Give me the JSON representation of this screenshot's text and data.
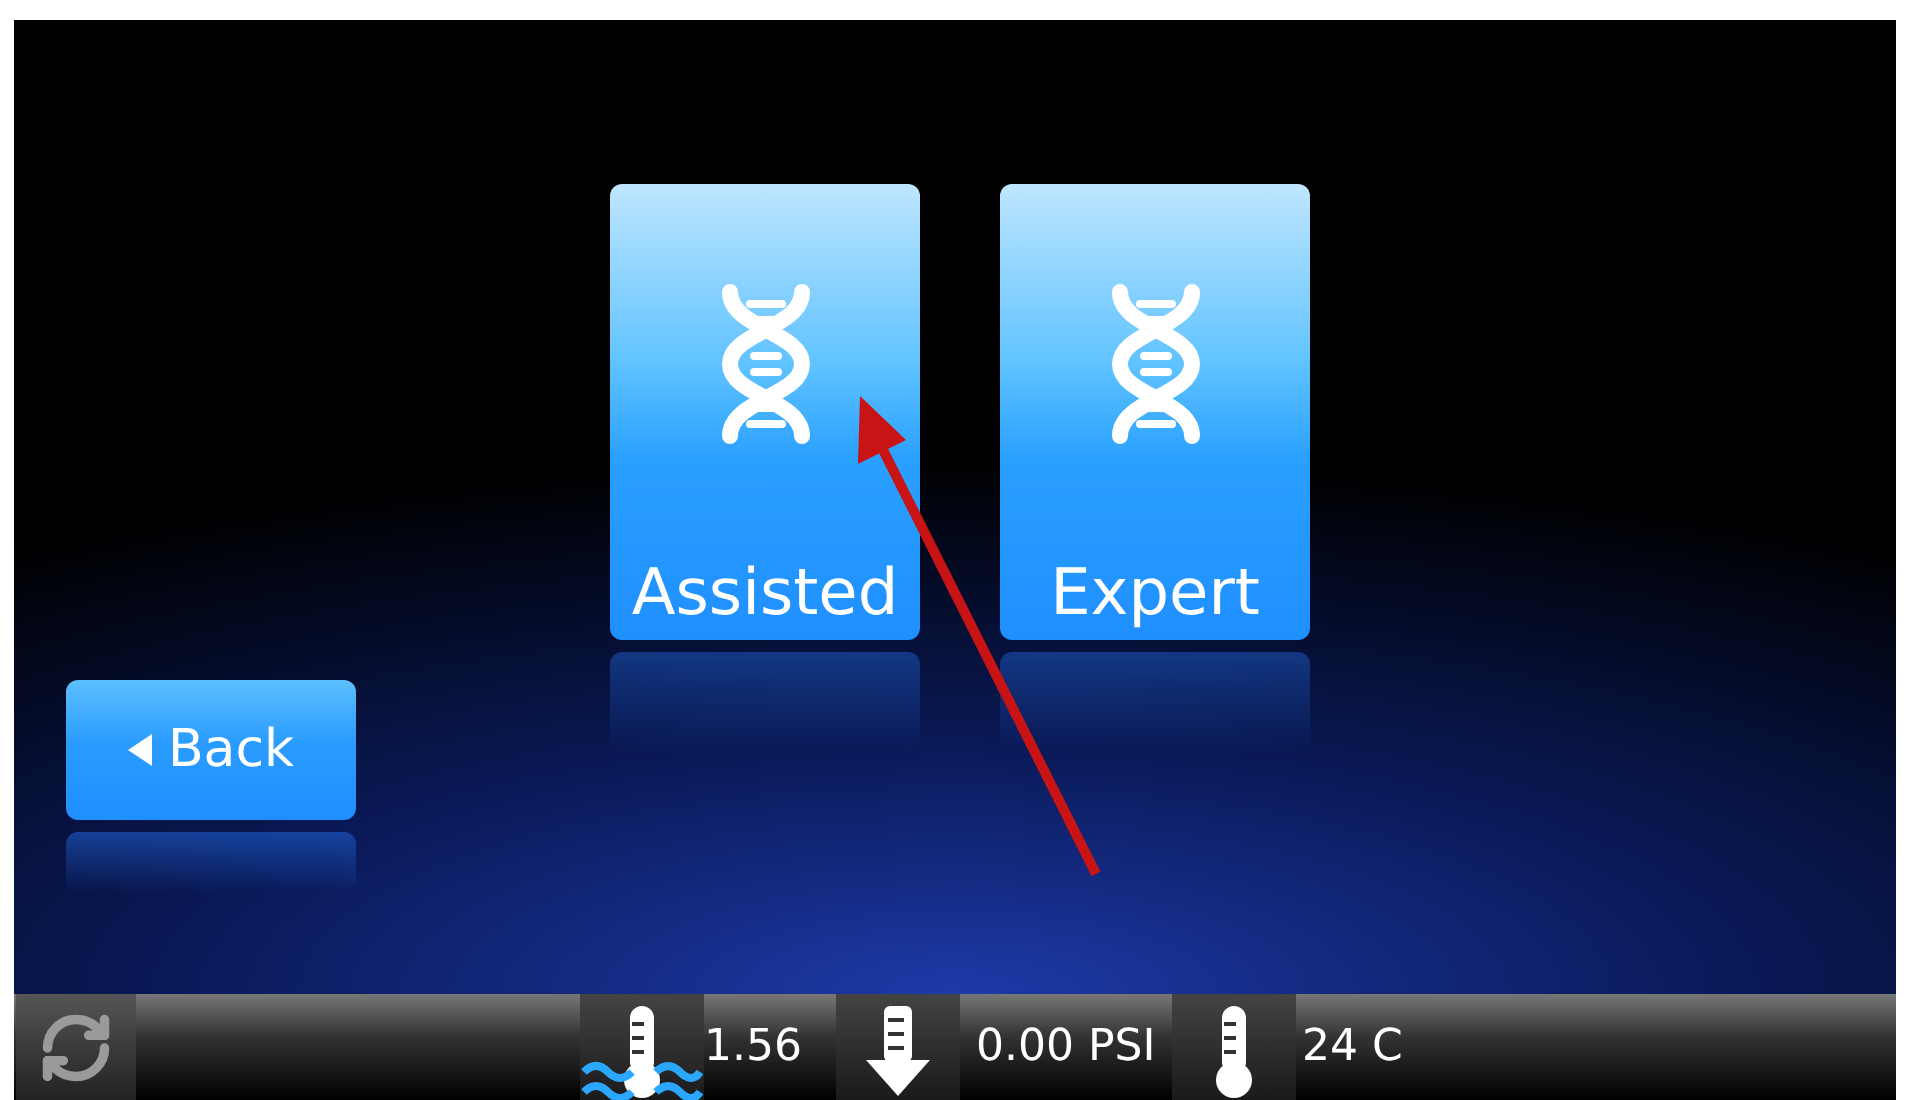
{
  "mode_buttons": [
    {
      "label": "Assisted"
    },
    {
      "label": "Expert"
    }
  ],
  "back_button": {
    "label": "Back"
  },
  "status_bar": {
    "readings": [
      {
        "kind": "flow",
        "value": "1.56"
      },
      {
        "kind": "pressure",
        "value": "0.00 PSI"
      },
      {
        "kind": "temperature",
        "value": "24 C"
      }
    ]
  }
}
